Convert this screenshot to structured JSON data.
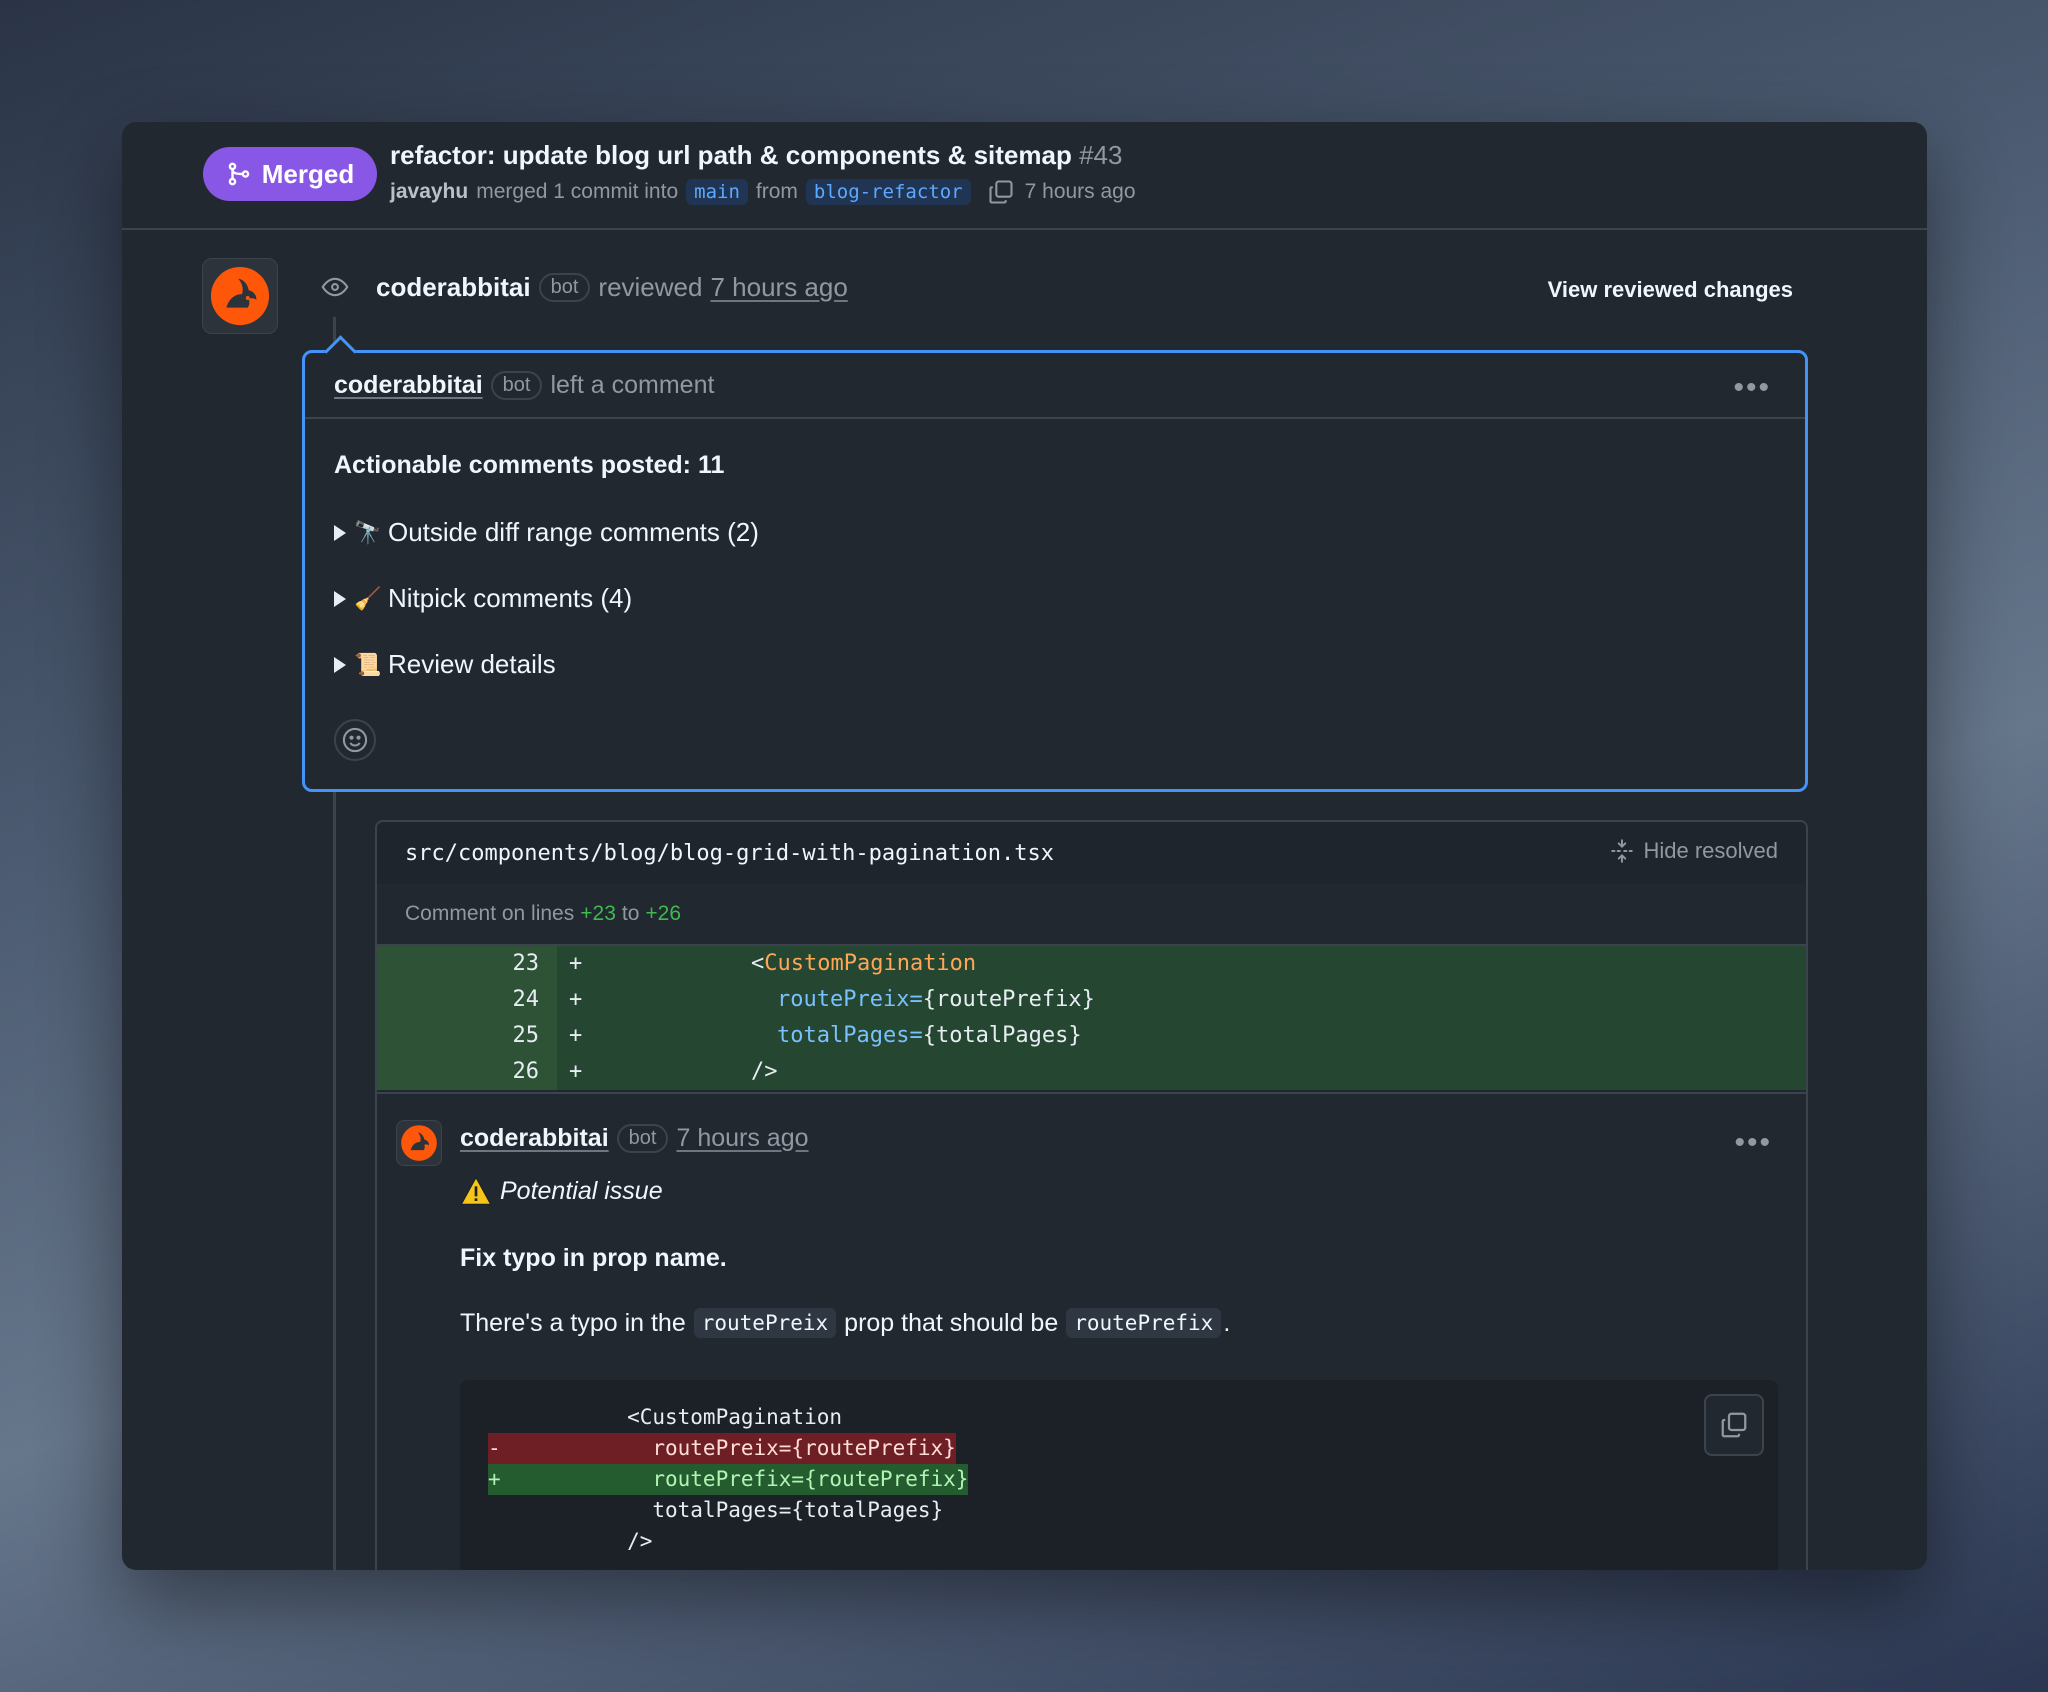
{
  "pr": {
    "state": "Merged",
    "title": "refactor: update blog url path & components & sitemap",
    "number": "#43",
    "author": "javayhu",
    "merged_text": "merged 1 commit into",
    "base_branch": "main",
    "from_text": "from",
    "head_branch": "blog-refactor",
    "time": "7 hours ago"
  },
  "review": {
    "user": "coderabbitai",
    "bot_label": "bot",
    "action": "reviewed",
    "time": "7 hours ago",
    "view_changes": "View reviewed changes"
  },
  "review_comment": {
    "user": "coderabbitai",
    "bot_label": "bot",
    "action": "left a comment",
    "title": "Actionable comments posted: 11",
    "items": [
      {
        "emoji": "🔭",
        "label": "Outside diff range comments (2)"
      },
      {
        "emoji": "🧹",
        "label": "Nitpick comments (4)"
      },
      {
        "emoji": "📜",
        "label": "Review details"
      }
    ]
  },
  "thread": {
    "file_path": "src/components/blog/blog-grid-with-pagination.tsx",
    "hide_resolved": "Hide resolved",
    "lines_prefix": "Comment on lines",
    "line_start": "+23",
    "lines_to": "to",
    "line_end": "+26",
    "diff": [
      {
        "num": "23",
        "sign": "+",
        "indent": "            ",
        "lt": "<",
        "tag": "CustomPagination",
        "attr": "",
        "rest": ""
      },
      {
        "num": "24",
        "sign": "+",
        "indent": "              ",
        "lt": "",
        "tag": "",
        "attr": "routePreix=",
        "rest": "{routePrefix}"
      },
      {
        "num": "25",
        "sign": "+",
        "indent": "              ",
        "lt": "",
        "tag": "",
        "attr": "totalPages=",
        "rest": "{totalPages}"
      },
      {
        "num": "26",
        "sign": "+",
        "indent": "            ",
        "lt": "",
        "tag": "",
        "attr": "",
        "rest": "/>"
      }
    ],
    "comment": {
      "user": "coderabbitai",
      "bot_label": "bot",
      "time": "7 hours ago",
      "issue": "Potential issue",
      "fix_title": "Fix typo in prop name.",
      "typo_pre": "There's a typo in the",
      "typo_code1": "routePreix",
      "typo_mid": "prop that should be",
      "typo_code2": "routePrefix",
      "typo_end": ".",
      "suggestion": [
        {
          "kind": "ctx",
          "text": "           <CustomPagination"
        },
        {
          "kind": "del",
          "text": "-            routePreix={routePrefix}"
        },
        {
          "kind": "add",
          "text": "+            routePrefix={routePrefix}"
        },
        {
          "kind": "ctx",
          "text": "             totalPages={totalPages}"
        },
        {
          "kind": "ctx",
          "text": "           />"
        }
      ]
    }
  },
  "colors": {
    "merged": "#8957e5",
    "accent_blue": "#4493f8",
    "add_bg": "#254630",
    "del_bg": "#6e1f25"
  }
}
